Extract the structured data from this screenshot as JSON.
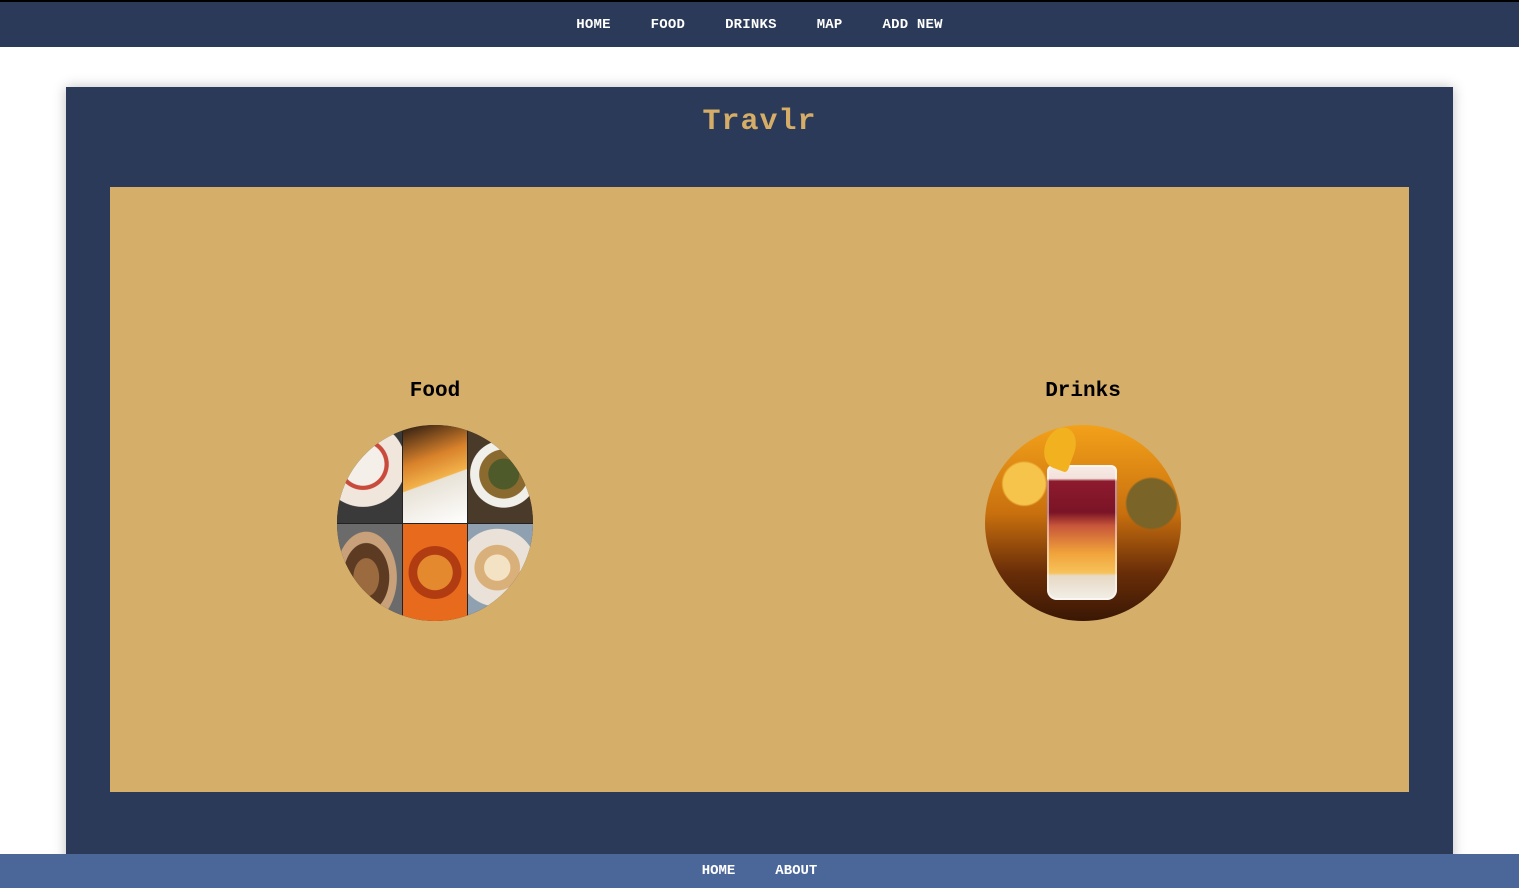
{
  "topnav": {
    "items": [
      {
        "label": "HOME"
      },
      {
        "label": "FOOD"
      },
      {
        "label": "DRINKS"
      },
      {
        "label": "MAP"
      },
      {
        "label": "ADD NEW"
      }
    ]
  },
  "site": {
    "title": "Travlr"
  },
  "cards": [
    {
      "heading": "Food",
      "image": "food-collage-image"
    },
    {
      "heading": "Drinks",
      "image": "cocktail-image"
    }
  ],
  "footer": {
    "items": [
      {
        "label": "HOME"
      },
      {
        "label": "ABOUT"
      }
    ]
  },
  "colors": {
    "navy": "#2b3a59",
    "gold": "#d5ae69",
    "title_gold": "#d6ad67",
    "footer_blue": "#4b679a"
  }
}
